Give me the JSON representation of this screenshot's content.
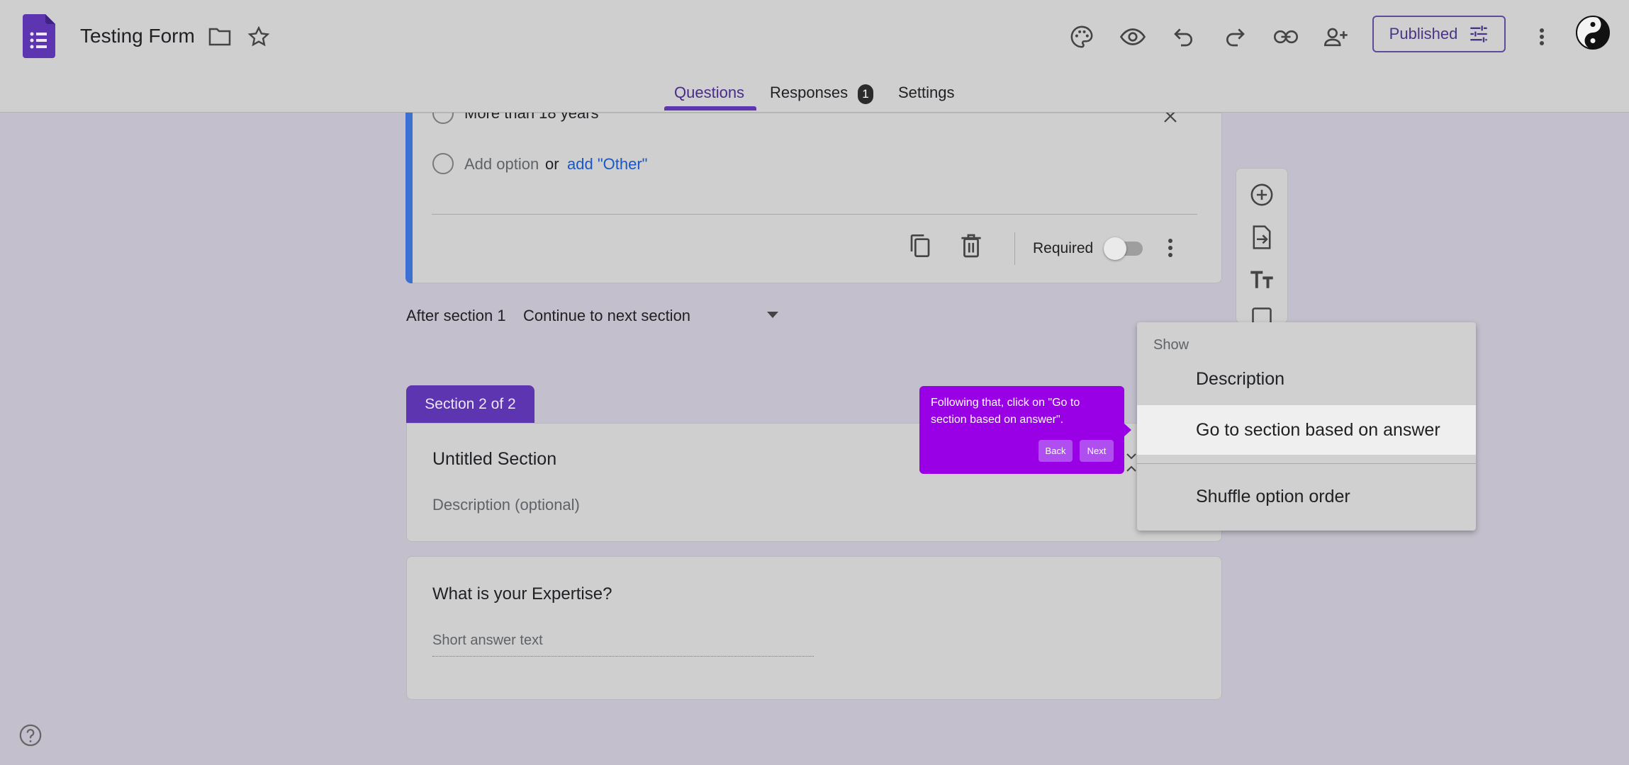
{
  "header": {
    "title": "Testing Form",
    "publish_label": "Published",
    "icons": [
      "forms-logo",
      "folder-icon",
      "star-icon",
      "palette-icon",
      "preview-eye-icon",
      "undo-icon",
      "redo-icon",
      "link-icon",
      "add-person-icon",
      "tune-icon",
      "more-vert-icon",
      "avatar"
    ]
  },
  "tabs": {
    "questions": "Questions",
    "responses": "Responses",
    "responses_count": "1",
    "settings": "Settings"
  },
  "question_card": {
    "partial_option": "More than 18 years",
    "add_option": "Add option",
    "or": "or",
    "add_other": "add \"Other\"",
    "required_label": "Required",
    "required_on": false
  },
  "after_section": {
    "label": "After section 1",
    "value": "Continue to next section"
  },
  "section2": {
    "tab_label": "Section 2 of 2",
    "title": "Untitled Section",
    "description_placeholder": "Description (optional)"
  },
  "question2": {
    "title": "What is your Expertise?",
    "answer_placeholder": "Short answer text"
  },
  "menu": {
    "header": "Show",
    "items": [
      "Description",
      "Go to section based on answer",
      "Shuffle option order"
    ],
    "highlighted_index": 1
  },
  "tooltip": {
    "text": "Following that, click on \"Go to section based on answer\".",
    "back": "Back",
    "next": "Next",
    "color": "#9a00e6"
  },
  "colors": {
    "accent": "#5e35b1",
    "question_bar": "#3b6fd1",
    "link": "#1a56c4"
  }
}
